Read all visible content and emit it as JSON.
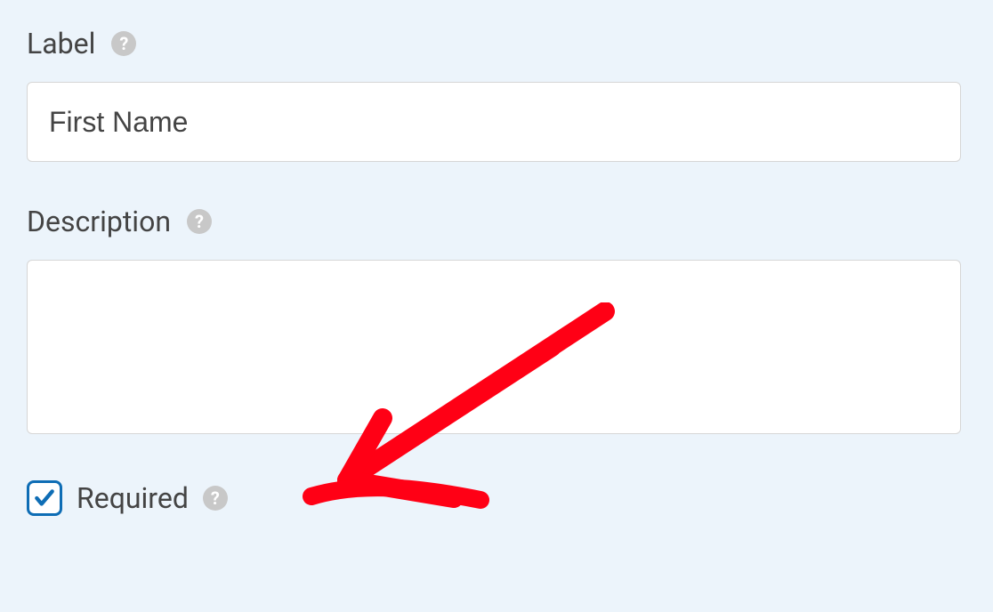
{
  "fields": {
    "label": {
      "label_text": "Label",
      "value": "First Name"
    },
    "description": {
      "label_text": "Description",
      "value": ""
    },
    "required": {
      "label_text": "Required",
      "checked": true
    }
  }
}
